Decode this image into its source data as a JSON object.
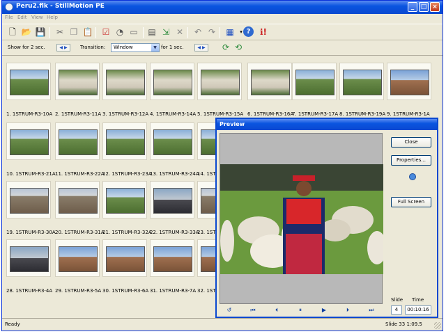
{
  "window": {
    "title": "Peru2.flk - StillMotion PE"
  },
  "menu": [
    "File",
    "Edit",
    "View",
    "Help"
  ],
  "toolbar": {
    "icons": [
      "new-icon",
      "open-icon",
      "save-icon",
      "cut-icon",
      "copy-icon",
      "paste-icon",
      "check-icon",
      "timer-icon",
      "blank-icon",
      "slideshow-icon",
      "export-icon",
      "delete-icon",
      "undo-icon",
      "redo-icon",
      "view-icon",
      "help-icon",
      "info-icon"
    ]
  },
  "options": {
    "show_for_label": "Show for 2 sec.",
    "transition_label": "Transition:",
    "transition_value": "Window",
    "for_label": "for 1 sec."
  },
  "thumbnails": [
    {
      "caption": "1. 1STRUM-R3-10A",
      "kind": "sky"
    },
    {
      "caption": "2. 1STRUM-R3-11A",
      "kind": "llama"
    },
    {
      "caption": "3. 1STRUM-R3-12A",
      "kind": "llama"
    },
    {
      "caption": "4. 1STRUM-R3-14A",
      "kind": "llama"
    },
    {
      "caption": "5. 1STRUM-R3-15A",
      "kind": "llama"
    },
    {
      "caption": "6. 1STRUM-R3-16A",
      "kind": "llama"
    },
    {
      "caption": "7. 1STRUM-R3-17A",
      "kind": "sky"
    },
    {
      "caption": "8. 1STRUM-R3-19A",
      "kind": "sky"
    },
    {
      "caption": "9. 1STRUM-R3-1A",
      "kind": "town"
    },
    {
      "caption": "10. 1STRUM-R3-21A",
      "kind": "sky"
    },
    {
      "caption": "11. 1STRUM-R3-22A",
      "kind": "sky"
    },
    {
      "caption": "12. 1STRUM-R3-23A",
      "kind": "sky"
    },
    {
      "caption": "13. 1STRUM-R3-24A",
      "kind": "sky"
    },
    {
      "caption": "14. 1STRUM-R3-2",
      "kind": "sky"
    },
    {
      "caption": "19. 1STRUM-R3-30A",
      "kind": "ruins"
    },
    {
      "caption": "20. 1STRUM-R3-31A",
      "kind": "ruins"
    },
    {
      "caption": "21. 1STRUM-R3-32A",
      "kind": "sky"
    },
    {
      "caption": "22. 1STRUM-R3-33A",
      "kind": "people"
    },
    {
      "caption": "23. 1STRUM-R3-3",
      "kind": "ruins"
    },
    {
      "caption": "28. 1STRUM-R3-4A",
      "kind": "people"
    },
    {
      "caption": "29. 1STRUM-R3-5A",
      "kind": "town"
    },
    {
      "caption": "30. 1STRUM-R3-6A",
      "kind": "town"
    },
    {
      "caption": "31. 1STRUM-R3-7A",
      "kind": "town"
    },
    {
      "caption": "32. 1STRUM-R3-",
      "kind": "town"
    }
  ],
  "preview": {
    "title": "Preview",
    "close_label": "Close",
    "properties_label": "Properties...",
    "fullscreen_label": "Full Screen",
    "slide_label": "Slide",
    "time_label": "Time",
    "slide_value": "4",
    "time_value": "00:10:16",
    "controls": [
      "loop-icon",
      "first-icon",
      "prev-icon",
      "pause-icon",
      "play-icon",
      "next-icon",
      "last-icon"
    ]
  },
  "status": {
    "left": "Ready",
    "right": "Slide 33  1:09.5"
  }
}
